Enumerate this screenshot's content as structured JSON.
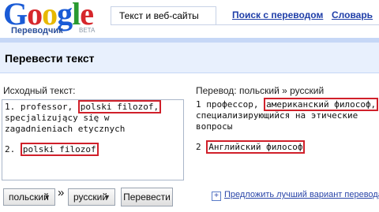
{
  "logo": {
    "letters": [
      "G",
      "o",
      "o",
      "g",
      "l",
      "e"
    ],
    "subtitle": "Переводчик",
    "beta": "BETA"
  },
  "tabs": [
    {
      "label": "Текст и веб-сайты",
      "active": true
    },
    {
      "label": "Поиск с переводом",
      "active": false
    },
    {
      "label": "Словарь",
      "active": false
    }
  ],
  "page_title": "Перевести текст",
  "source": {
    "label": "Исходный текст:",
    "item1": {
      "num": "1.",
      "pre": "professor,",
      "hl": "polski filozof,",
      "rest1": "specjalizujący się w",
      "rest2": "zagadnieniach etycznych"
    },
    "item2": {
      "num": "2.",
      "hl": "polski filozof"
    }
  },
  "result": {
    "label": "Перевод: польский » русский",
    "item1": {
      "num": "1",
      "pre": "профессор,",
      "hl": "американский философ,",
      "rest1": "специализирующийся на этические",
      "rest2": "вопросы"
    },
    "item2": {
      "num": "2",
      "hl": "Английский философ"
    }
  },
  "controls": {
    "source_lang": "польский",
    "swap_symbol": "»",
    "target_lang": "русский",
    "translate_button": "Перевести",
    "suggest_link": "Предложить лучший вариант перевода"
  },
  "colors": {
    "highlight_border": "#d0202a",
    "link": "#1f3ea8",
    "title_bar": "#e8f0fd"
  }
}
